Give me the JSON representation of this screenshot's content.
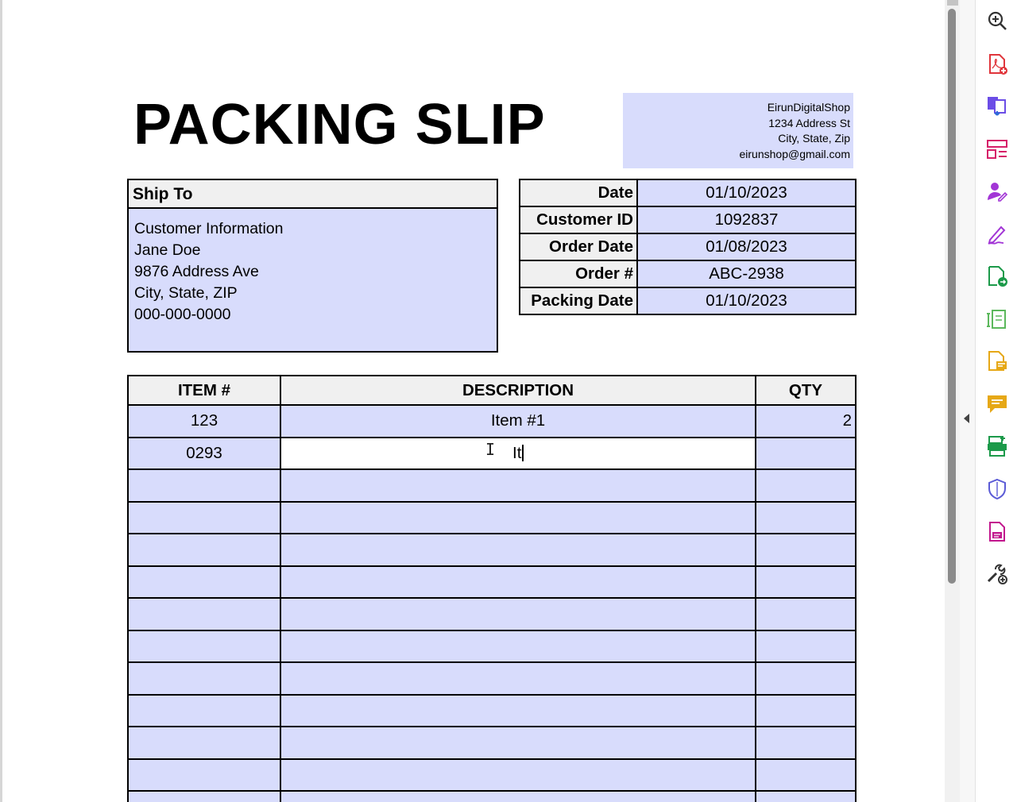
{
  "document": {
    "title": "PACKING SLIP",
    "shop": {
      "name": "EirunDigitalShop",
      "address": "1234 Address St",
      "city": "City, State, Zip",
      "email": "eirunshop@gmail.com"
    },
    "ship_to": {
      "header": "Ship To",
      "lines": [
        "Customer Information",
        "Jane Doe",
        "9876 Address Ave",
        "City, State, ZIP",
        "000-000-0000"
      ]
    },
    "info": [
      {
        "label": "Date",
        "value": "01/10/2023"
      },
      {
        "label": "Customer ID",
        "value": "1092837"
      },
      {
        "label": "Order Date",
        "value": "01/08/2023"
      },
      {
        "label": "Order #",
        "value": "ABC-2938"
      },
      {
        "label": "Packing Date",
        "value": "01/10/2023"
      }
    ],
    "items": {
      "headers": {
        "item": "ITEM #",
        "description": "DESCRIPTION",
        "qty": "QTY"
      },
      "rows": [
        {
          "item": "123",
          "description": "Item #1",
          "qty": "2"
        },
        {
          "item": "0293",
          "description": "It",
          "qty": ""
        },
        {
          "item": "",
          "description": "",
          "qty": ""
        },
        {
          "item": "",
          "description": "",
          "qty": ""
        },
        {
          "item": "",
          "description": "",
          "qty": ""
        },
        {
          "item": "",
          "description": "",
          "qty": ""
        },
        {
          "item": "",
          "description": "",
          "qty": ""
        },
        {
          "item": "",
          "description": "",
          "qty": ""
        },
        {
          "item": "",
          "description": "",
          "qty": ""
        },
        {
          "item": "",
          "description": "",
          "qty": ""
        },
        {
          "item": "",
          "description": "",
          "qty": ""
        },
        {
          "item": "",
          "description": "",
          "qty": ""
        },
        {
          "item": "",
          "description": "",
          "qty": ""
        }
      ]
    }
  },
  "toolbar": {
    "tools": [
      {
        "icon": "zoom-in-icon",
        "color": "#333333"
      },
      {
        "icon": "create-pdf-icon",
        "color": "#e0353b"
      },
      {
        "icon": "combine-files-icon",
        "color": "#6b4de6"
      },
      {
        "icon": "organize-pages-icon",
        "color": "#d61f69"
      },
      {
        "icon": "request-signatures-icon",
        "color": "#a235d6"
      },
      {
        "icon": "fill-sign-icon",
        "color": "#a235d6"
      },
      {
        "icon": "export-pdf-icon",
        "color": "#1c9a4a"
      },
      {
        "icon": "edit-pdf-icon",
        "color": "#5cb85c"
      },
      {
        "icon": "send-for-review-icon",
        "color": "#e6a817"
      },
      {
        "icon": "comment-icon",
        "color": "#e6a817"
      },
      {
        "icon": "scan-ocr-icon",
        "color": "#1c9a4a"
      },
      {
        "icon": "protect-icon",
        "color": "#5b5bd6"
      },
      {
        "icon": "pdf-standards-icon",
        "color": "#c2188e"
      },
      {
        "icon": "more-tools-icon",
        "color": "#333333"
      }
    ]
  }
}
